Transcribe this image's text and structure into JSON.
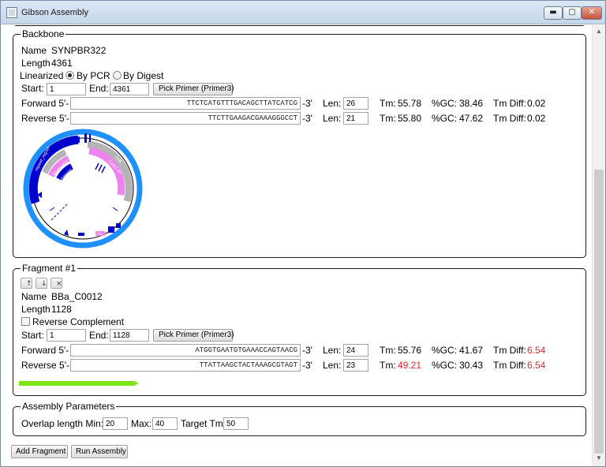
{
  "window": {
    "title": "Gibson Assembly",
    "controls": [
      "minimize",
      "maximize",
      "close"
    ]
  },
  "backbone": {
    "legend": "Backbone",
    "name_label": "Name",
    "name": "SYNPBR322",
    "length_label": "Length",
    "length": "4361",
    "linearized_label": "Linearized",
    "by_pcr_label": "By PCR",
    "by_digest_label": "By Digest",
    "linearized_selected": "By PCR",
    "start_label": "Start:",
    "start": "1",
    "end_label": "End:",
    "end": "4361",
    "pick_primer_label": "Pick Primer (Primer3)",
    "forward": {
      "label": "Forward 5'-",
      "sequence": "TTCTCATGTTTGACAGCTTATCATCG",
      "suffix": "-3'",
      "len_label": "Len:",
      "len": "26",
      "tm_label": "Tm:",
      "tm": "55.78",
      "gc_label": "%GC:",
      "gc": "38.46",
      "tmdiff_label": "Tm Diff:",
      "tmdiff": "0.02"
    },
    "reverse": {
      "label": "Reverse 5'-",
      "sequence": "TTCTTGAAGACGAAAGGGCCT",
      "suffix": "-3'",
      "len_label": "Len:",
      "len": "21",
      "tm_label": "Tm:",
      "tm": "55.80",
      "gc_label": "%GC:",
      "gc": "47.62",
      "tmdiff_label": "Tm Diff:",
      "tmdiff": "0.02"
    },
    "plasmid_map": {
      "features": [
        "repeat_region",
        "rrnB",
        "ColE1 ori",
        "terminator",
        "promoter",
        "rbs"
      ]
    }
  },
  "fragment": {
    "legend": "Fragment #1",
    "move_up_label": "↑",
    "move_down_label": "↓",
    "remove_label": "×",
    "name_label": "Name",
    "name": "BBa_C0012",
    "length_label": "Length",
    "length": "1128",
    "reverse_complement_label": "Reverse Complement",
    "reverse_complement_checked": false,
    "start_label": "Start:",
    "start": "1",
    "end_label": "End:",
    "end": "1128",
    "pick_primer_label": "Pick Primer (Primer3)",
    "forward": {
      "label": "Forward 5'-",
      "sequence": "ATGGTGAATGTGAAACCAGTAACG",
      "suffix": "-3'",
      "len_label": "Len:",
      "len": "24",
      "tm_label": "Tm:",
      "tm": "55.76",
      "gc_label": "%GC:",
      "gc": "41.67",
      "tmdiff_label": "Tm Diff:",
      "tmdiff": "6.54"
    },
    "reverse": {
      "label": "Reverse 5'-",
      "sequence": "TTATTAAGCTACTAAAGCGTAGT",
      "suffix": "-3'",
      "len_label": "Len:",
      "len": "23",
      "tm_label": "Tm:",
      "tm": "49.21",
      "gc_label": "%GC:",
      "gc": "30.43",
      "tmdiff_label": "Tm Diff:",
      "tmdiff": "6.54"
    },
    "bar_color": "#7fe51b"
  },
  "assembly_parameters": {
    "legend": "Assembly Parameters",
    "overlap_label": "Overlap length Min:",
    "min": "20",
    "max_label": "Max:",
    "max": "40",
    "target_tm_label": "Target Tm",
    "target_tm": "50"
  },
  "buttons": {
    "add_fragment": "Add Fragment",
    "run_assembly": "Run Assembly"
  },
  "colors": {
    "warning": "#e8262a",
    "map_outer": "#1e90ff",
    "map_feature_dark": "#0000cc",
    "map_feature_pink": "#ee82ee",
    "map_feature_gray": "#b4b4b4"
  }
}
